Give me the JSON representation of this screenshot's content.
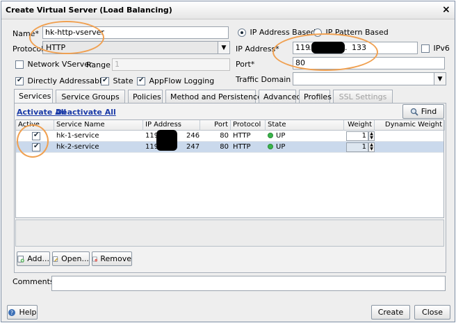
{
  "window": {
    "title": "Create Virtual Server (Load Balancing)",
    "close_glyph": "×"
  },
  "form": {
    "name_label": "Name*",
    "name_value": "hk-http-vserver",
    "protocol_label": "Protocol",
    "protocol_value": "HTTP",
    "network_vserver_label": "Network VServer",
    "range_label": "Range",
    "range_value": "1",
    "directly_addressable_label": "Directly Addressable",
    "state_label": "State",
    "appflow_label": "AppFlow Logging",
    "ip_address_based_label": "IP Address Based",
    "ip_pattern_based_label": "IP Pattern Based",
    "ip_address_label": "IP Address*",
    "ip_part1": "119",
    "ip_dot": ".",
    "ip_part4": "133",
    "ipv6_label": "IPv6",
    "port_label": "Port*",
    "port_value": "80",
    "traffic_domain_label": "Traffic Domain ID",
    "traffic_domain_value": ""
  },
  "tabs": [
    {
      "label": "Services"
    },
    {
      "label": "Service Groups"
    },
    {
      "label": "Policies"
    },
    {
      "label": "Method and Persistence"
    },
    {
      "label": "Advanced"
    },
    {
      "label": "Profiles"
    },
    {
      "label": "SSL Settings"
    }
  ],
  "services": {
    "activate_all": "Activate All",
    "deactivate_all": "Deactivate All",
    "find_label": "Find",
    "columns": [
      "Active",
      "Service Name",
      "IP Address",
      "Port",
      "Protocol",
      "State",
      "Weight",
      "Dynamic Weight"
    ],
    "rows": [
      {
        "active": true,
        "name": "hk-1-service",
        "ip_prefix": "119",
        "ip_suffix": "246",
        "port": "80",
        "protocol": "HTTP",
        "state": "UP",
        "weight": "1",
        "dynamic_weight": ""
      },
      {
        "active": true,
        "name": "hk-2-service",
        "ip_prefix": "119",
        "ip_suffix": "247",
        "port": "80",
        "protocol": "HTTP",
        "state": "UP",
        "weight": "1",
        "dynamic_weight": ""
      }
    ],
    "add_label": "Add...",
    "open_label": "Open...",
    "remove_label": "Remove"
  },
  "comments": {
    "label": "Comments",
    "value": ""
  },
  "footer": {
    "help_label": "Help",
    "create_label": "Create",
    "close_label": "Close"
  },
  "colors": {
    "annotation": "#f0a050",
    "status_up": "#39b54a",
    "selected_row": "#cad9ec",
    "link": "#1a3aa8"
  }
}
